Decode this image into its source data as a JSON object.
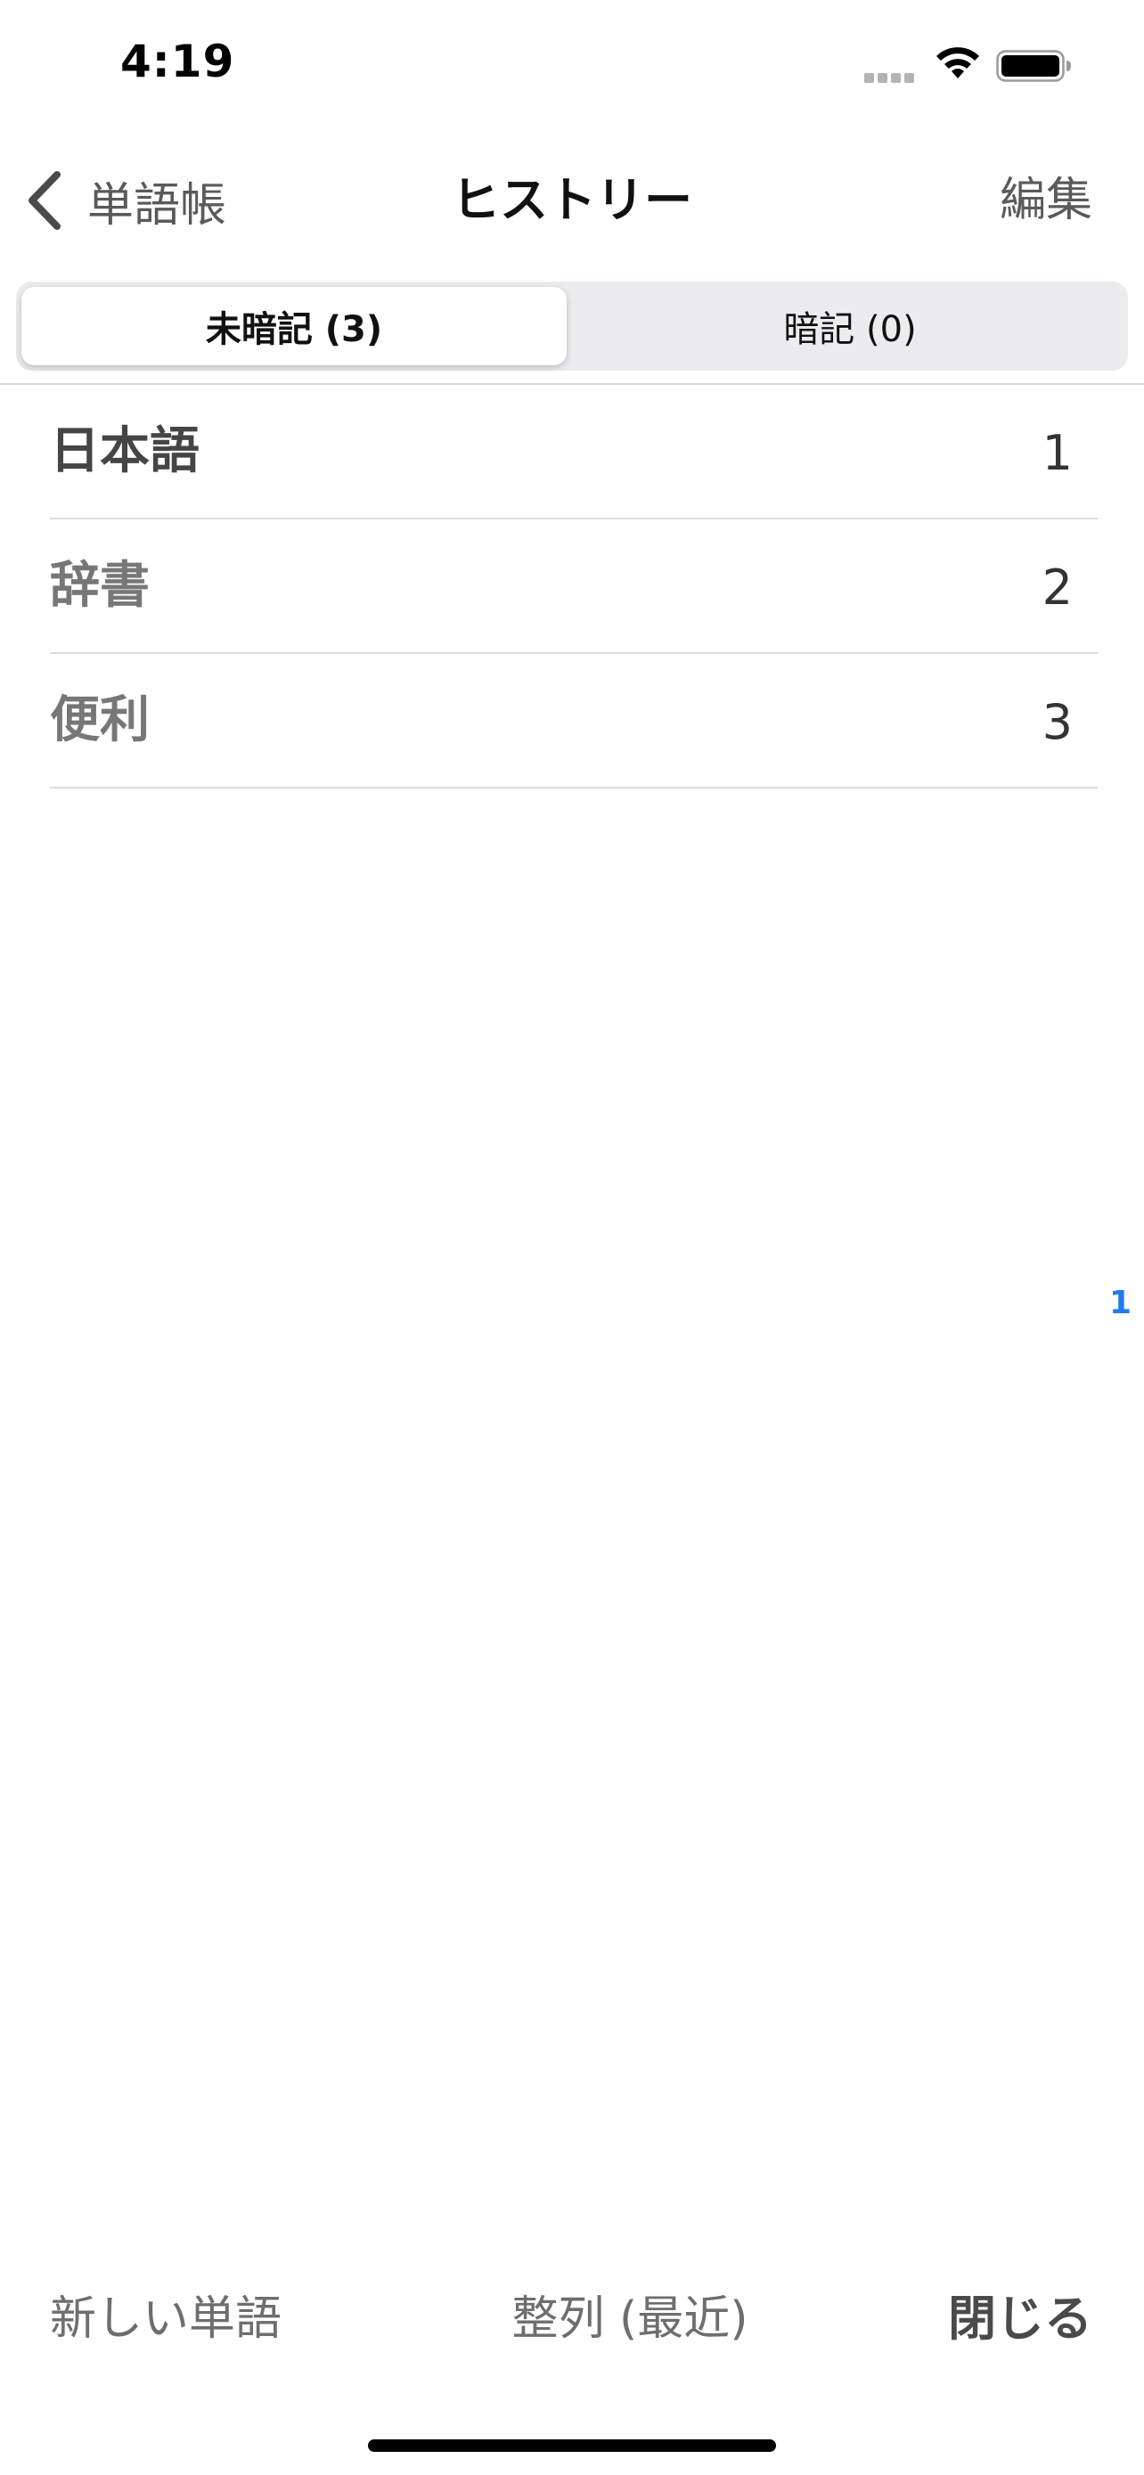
{
  "status_bar": {
    "time": "4:19",
    "icons": [
      "cellular-signal-icon",
      "wifi-icon",
      "battery-icon"
    ]
  },
  "nav": {
    "back_label": "単語帳",
    "title": "ヒストリー",
    "edit_label": "編集"
  },
  "segments": [
    {
      "label": "未暗記 (3)",
      "selected": true
    },
    {
      "label": "暗記 (0)",
      "selected": false
    }
  ],
  "words": [
    {
      "word": "日本語",
      "count": "1"
    },
    {
      "word": "辞書",
      "count": "2"
    },
    {
      "word": "便利",
      "count": "3"
    }
  ],
  "index_marker": "1",
  "toolbar": {
    "new_word_label": "新しい単語",
    "sort_label": "整列 (最近)",
    "close_label": "閉じる"
  },
  "colors": {
    "accent": "#1e7bf0",
    "segment_background": "#ececee",
    "divider": "#dcdcdc"
  }
}
